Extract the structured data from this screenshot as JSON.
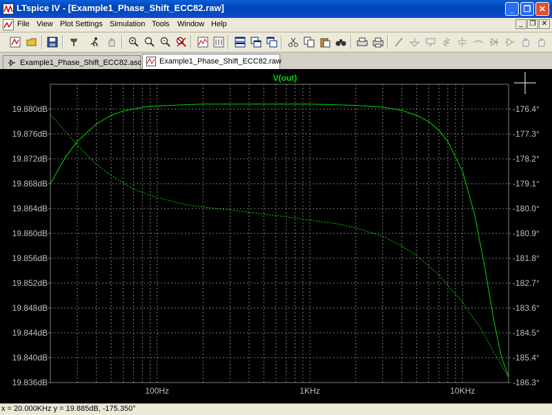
{
  "window": {
    "title": "LTspice IV - [Example1_Phase_Shift_ECC82.raw]",
    "min_label": "_",
    "max_label": "❐",
    "close_label": "✕"
  },
  "menu": {
    "items": [
      "File",
      "View",
      "Plot Settings",
      "Simulation",
      "Tools",
      "Window",
      "Help"
    ],
    "mdi_controls": [
      "_",
      "❐",
      "✕"
    ]
  },
  "toolbar": {
    "icons": [
      "new-schematic-icon",
      "open-icon",
      "save-icon",
      "control-panel-icon",
      "run-icon",
      "halt-icon",
      "zoom-in-icon",
      "zoom-out-icon",
      "zoom-fit-icon",
      "zoom-cancel-icon",
      "autorange-icon",
      "plot-manage-icon",
      "tile-horizontal-icon",
      "cascade-icon",
      "tile-icon",
      "cut-icon",
      "copy-icon",
      "paste-icon",
      "find-icon",
      "print-setup-icon",
      "print-icon",
      "wire-icon",
      "ground-icon",
      "label-icon",
      "resistor-icon",
      "capacitor-icon",
      "inductor-icon",
      "diode-icon",
      "component-icon",
      "move-icon",
      "drag-icon"
    ]
  },
  "tabs": [
    {
      "label": "Example1_Phase_Shift_ECC82.asc",
      "active": false
    },
    {
      "label": "Example1_Phase_Shift_ECC82.raw",
      "active": true
    }
  ],
  "statusbar": {
    "text": "x = 20.000KHz    y = 19.885dB, -175.350°"
  },
  "chart_data": {
    "type": "line",
    "title": "V(out)",
    "x_scale": "log",
    "xlim": [
      20,
      20000
    ],
    "x_tick_labels": [
      "100Hz",
      "1KHz",
      "10KHz"
    ],
    "x_tick_values": [
      100,
      1000,
      10000
    ],
    "ylim_left": [
      19.836,
      19.884
    ],
    "y_tick_labels_left": [
      "19.880dB",
      "19.876dB",
      "19.872dB",
      "19.868dB",
      "19.864dB",
      "19.860dB",
      "19.856dB",
      "19.852dB",
      "19.848dB",
      "19.844dB",
      "19.840dB",
      "19.836dB"
    ],
    "y_tick_values_left": [
      19.88,
      19.876,
      19.872,
      19.868,
      19.864,
      19.86,
      19.856,
      19.852,
      19.848,
      19.844,
      19.84,
      19.836
    ],
    "ylim_right": [
      -186.3,
      -175.5
    ],
    "y_tick_labels_right": [
      "-176.4°",
      "-177.3°",
      "-178.2°",
      "-179.1°",
      "-180.0°",
      "-180.9°",
      "-181.8°",
      "-182.7°",
      "-183.6°",
      "-184.5°",
      "-185.4°",
      "-186.3°"
    ],
    "y_tick_values_right": [
      -176.4,
      -177.3,
      -178.2,
      -179.1,
      -180.0,
      -180.9,
      -181.8,
      -182.7,
      -183.6,
      -184.5,
      -185.4,
      -186.3
    ],
    "grid": true,
    "series": [
      {
        "axis": "left",
        "style": "solid",
        "color": "#00dd00",
        "x": [
          20,
          25,
          30,
          40,
          50,
          60,
          80,
          100,
          150,
          200,
          300,
          500,
          700,
          1000,
          1500,
          2000,
          3000,
          4000,
          5000,
          6000,
          7000,
          8000,
          10000,
          12000,
          14000,
          16000,
          18000,
          20000
        ],
        "y": [
          19.868,
          19.8722,
          19.8748,
          19.8776,
          19.879,
          19.8797,
          19.8803,
          19.8805,
          19.8807,
          19.8808,
          19.8808,
          19.8808,
          19.8808,
          19.8808,
          19.8807,
          19.8806,
          19.8803,
          19.8798,
          19.879,
          19.878,
          19.8766,
          19.8748,
          19.87,
          19.863,
          19.8545,
          19.846,
          19.84,
          19.837
        ]
      },
      {
        "axis": "right",
        "style": "dashed",
        "color": "#00dd00",
        "x": [
          20,
          30,
          40,
          50,
          70,
          100,
          150,
          200,
          300,
          500,
          700,
          1000,
          1500,
          2000,
          3000,
          4000,
          5000,
          7000,
          10000,
          13000,
          16000,
          20000
        ],
        "y": [
          -176.6,
          -177.7,
          -178.4,
          -178.8,
          -179.3,
          -179.6,
          -179.85,
          -179.95,
          -180.05,
          -180.2,
          -180.3,
          -180.42,
          -180.55,
          -180.7,
          -181.0,
          -181.35,
          -181.7,
          -182.4,
          -183.4,
          -184.3,
          -185.2,
          -186.1
        ]
      }
    ]
  }
}
